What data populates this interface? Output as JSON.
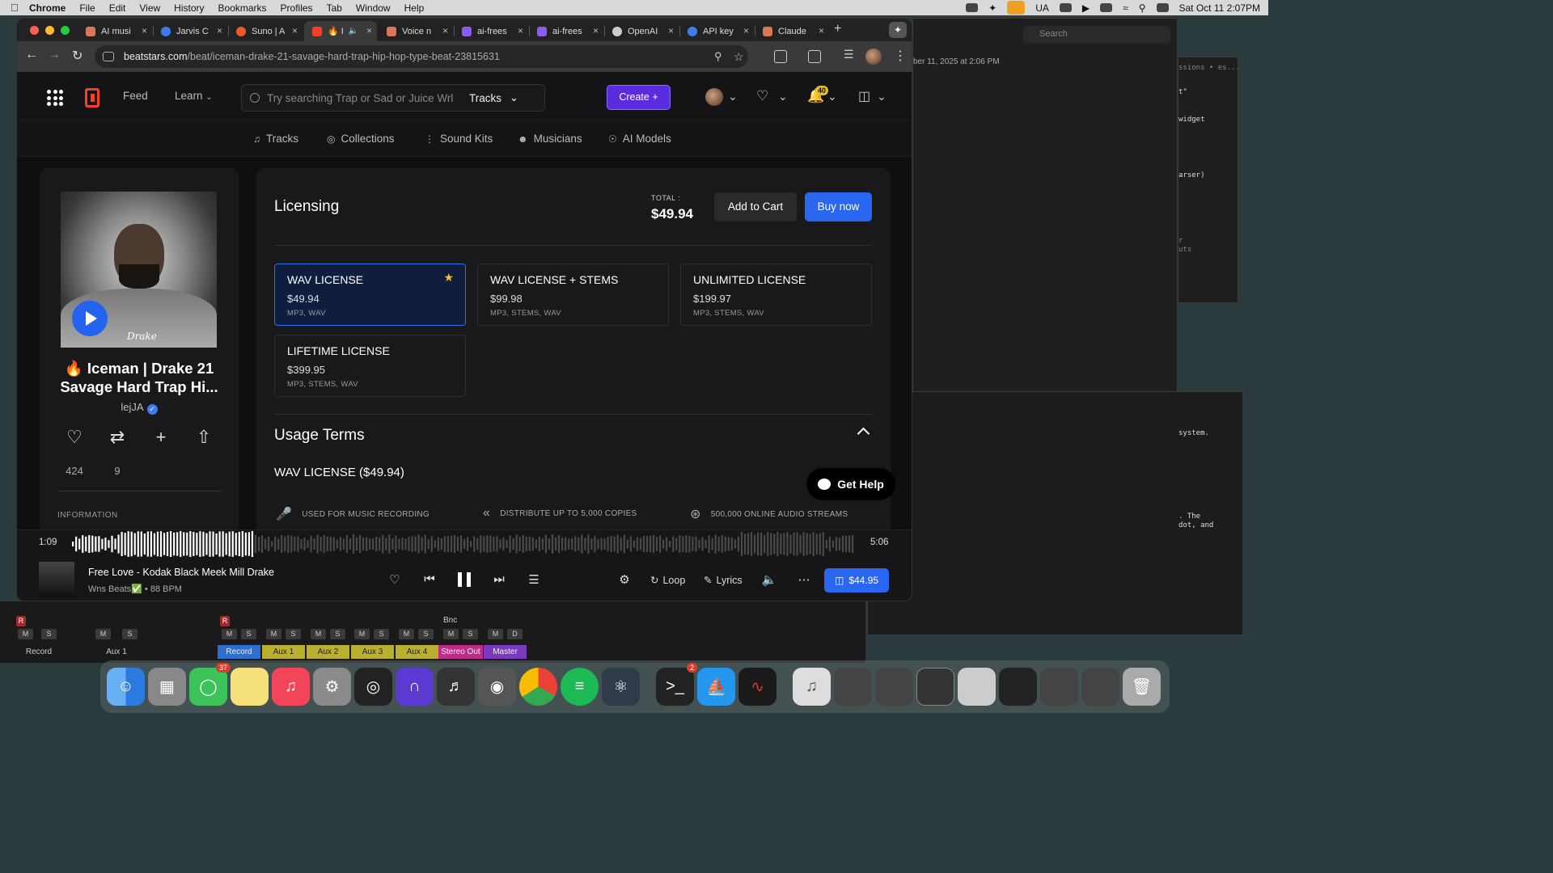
{
  "menubar": {
    "app": "Chrome",
    "items": [
      "File",
      "Edit",
      "View",
      "History",
      "Bookmarks",
      "Profiles",
      "Tab",
      "Window",
      "Help"
    ],
    "lang": "UA",
    "datetime": "Sat Oct 11  2:07PM"
  },
  "tabs": [
    {
      "label": "AI musi",
      "color": "#d97757"
    },
    {
      "label": "Jarvis C",
      "color": "#3d7cf0"
    },
    {
      "label": "Suno | A",
      "color": "#f05a28"
    },
    {
      "label": "🔥 I",
      "color": "#f4402b"
    },
    {
      "label": "Voice n",
      "color": "#d97757"
    },
    {
      "label": "ai-frees",
      "color": "#8a5cf0"
    },
    {
      "label": "ai-frees",
      "color": "#8a5cf0"
    },
    {
      "label": "OpenAI",
      "color": "#cccccc"
    },
    {
      "label": "API key",
      "color": "#3d7cf0"
    },
    {
      "label": "Claude",
      "color": "#d97757"
    }
  ],
  "url": {
    "host": "beatstars.com",
    "path": "/beat/iceman-drake-21-savage-hard-trap-hip-hop-type-beat-23815631"
  },
  "header": {
    "feed": "Feed",
    "learn": "Learn",
    "search_placeholder": "Try searching Trap or Sad or Juice Wrl",
    "search_scope": "Tracks",
    "create": "Create",
    "notif_count": "40"
  },
  "subnav": [
    "Tracks",
    "Collections",
    "Sound Kits",
    "Musicians",
    "AI Models"
  ],
  "beat": {
    "title": "🔥 Iceman | Drake 21 Savage Hard Trap Hi...",
    "artist": "lejJA",
    "likes": "424",
    "reposts": "9",
    "info_label": "INFORMATION",
    "cover_signature": "Drake"
  },
  "licensing": {
    "heading": "Licensing",
    "total_label": "TOTAL :",
    "total": "$49.94",
    "add_to_cart": "Add to Cart",
    "buy_now": "Buy now",
    "licenses": [
      {
        "name": "WAV LICENSE",
        "price": "$49.94",
        "formats": "MP3, WAV",
        "selected": true
      },
      {
        "name": "WAV LICENSE + STEMS",
        "price": "$99.98",
        "formats": "MP3, STEMS, WAV",
        "selected": false
      },
      {
        "name": "UNLIMITED LICENSE",
        "price": "$199.97",
        "formats": "MP3, STEMS, WAV",
        "selected": false
      },
      {
        "name": "LIFETIME LICENSE",
        "price": "$399.95",
        "formats": "MP3, STEMS, WAV",
        "selected": false
      }
    ],
    "usage_heading": "Usage Terms",
    "usage_license": "WAV LICENSE ($49.94)",
    "terms": [
      "USED FOR MUSIC RECORDING",
      "DISTRIBUTE UP TO 5,000 COPIES",
      "500,000 ONLINE AUDIO STREAMS"
    ]
  },
  "get_help": "Get Help",
  "player": {
    "current": "1:09",
    "duration": "5:06",
    "progress": 0.23,
    "title": "Free Love - Kodak Black Meek Mill Drake",
    "subtitle": "Wns Beats✅ • 88 BPM",
    "loop": "Loop",
    "lyrics": "Lyrics",
    "price": "$44.95"
  },
  "background": {
    "timestamp": "ber 11, 2025 at 2:06 PM",
    "search": "Search",
    "snippets": [
      "ssions • es...",
      "t\"",
      "widget",
      "arser)",
      "r",
      "uts",
      "system.",
      ". The",
      "dot, and"
    ]
  },
  "mixer": {
    "channels": [
      {
        "label": "Record",
        "color": "#2b6fd0"
      },
      {
        "label": "Aux 1",
        "color": "#b9b030"
      },
      {
        "label": "Aux 2",
        "color": "#b9b030"
      },
      {
        "label": "Aux 3",
        "color": "#b9b030"
      },
      {
        "label": "Aux 4",
        "color": "#b9b030"
      },
      {
        "label": "Stereo Out",
        "color": "#c02a8a"
      },
      {
        "label": "Master",
        "color": "#7a3ac0"
      }
    ],
    "left_labels": [
      "Record",
      "Aux 1"
    ],
    "bnc": "Bnc"
  },
  "dock": {
    "messages_badge": "37",
    "terminal_badge": "2"
  }
}
